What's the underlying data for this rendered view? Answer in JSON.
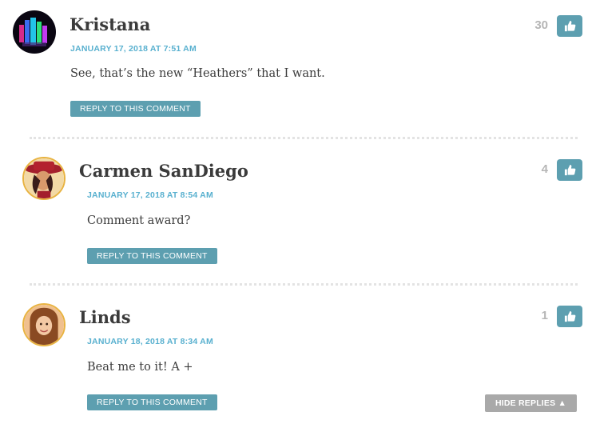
{
  "comments": [
    {
      "author": "Kristana",
      "date": "JANUARY 17, 2018 AT 7:51 AM",
      "text": "See, that’s the new “Heathers” that I want.",
      "reply_label": "REPLY TO THIS COMMENT",
      "votes": "30",
      "avatar_icon": "crystal-avatar-icon"
    },
    {
      "author": "Carmen SanDiego",
      "date": "JANUARY 17, 2018 AT 8:54 AM",
      "text": "Comment award?",
      "reply_label": "REPLY TO THIS COMMENT",
      "votes": "4",
      "avatar_icon": "carmen-avatar-icon"
    },
    {
      "author": "Linds",
      "date": "JANUARY 18, 2018 AT 8:34 AM",
      "text": "Beat me to it! A +",
      "reply_label": "REPLY TO THIS COMMENT",
      "votes": "1",
      "avatar_icon": "portrait-avatar-icon"
    }
  ],
  "hide_replies_label": "HIDE REPLIES ▲",
  "colors": {
    "accent": "#5d9fb0",
    "date": "#58b0cf",
    "avatar_ring": "#e8b341",
    "hide_button": "#a9a9a9"
  },
  "icons": {
    "like": "thumbs-up-icon"
  }
}
